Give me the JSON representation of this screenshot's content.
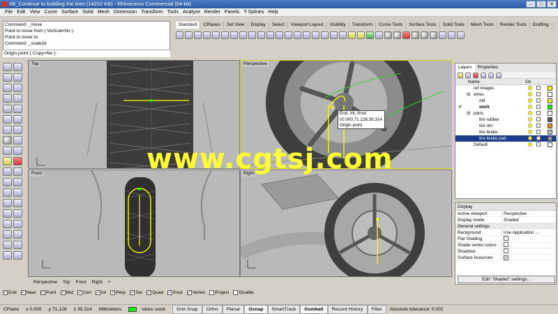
{
  "window": {
    "title": "06_Continue to building the tires (14202 KB) - Rhinoceros Commercial (64-bit)"
  },
  "menu": [
    "File",
    "Edit",
    "View",
    "Curve",
    "Surface",
    "Solid",
    "Mesh",
    "Dimension",
    "Transform",
    "Tools",
    "Analyze",
    "Render",
    "Panels",
    "T-Splines",
    "Help"
  ],
  "command_history": [
    "Command: _move",
    "Point to move from ( Vertical=No ):",
    "Point to move to:",
    "Command: _scale2d"
  ],
  "command_prompt": "Origin point ( Copy=No ):",
  "toolbar_tabs": [
    "Standard",
    "CPlanes",
    "Set View",
    "Display",
    "Select",
    "Viewport Layout",
    "Visibility",
    "Transform",
    "Curve Tools",
    "Surface Tools",
    "Solid Tools",
    "Mesh Tools",
    "Render Tools",
    "Drafting"
  ],
  "viewports": {
    "top": "Top",
    "perspective": "Perspective",
    "front": "Front",
    "right": "Right"
  },
  "snap_tooltip": [
    "End, Int, Knot",
    "c0.000,71.128,35.314",
    "Origin point"
  ],
  "viewport_tabs": [
    "Perspective",
    "Top",
    "Front",
    "Right",
    "+"
  ],
  "osnaps": [
    {
      "label": "End",
      "checked": true
    },
    {
      "label": "Near",
      "checked": true
    },
    {
      "label": "Point",
      "checked": true
    },
    {
      "label": "Mid",
      "checked": true
    },
    {
      "label": "Cen",
      "checked": true
    },
    {
      "label": "Int",
      "checked": true
    },
    {
      "label": "Perp",
      "checked": true
    },
    {
      "label": "Tan",
      "checked": true
    },
    {
      "label": "Quad",
      "checked": true
    },
    {
      "label": "Knot",
      "checked": true
    },
    {
      "label": "Vertex",
      "checked": true
    },
    {
      "label": "Project",
      "checked": false
    },
    {
      "label": "Disable",
      "checked": false
    }
  ],
  "status": {
    "cplane": "CPlane",
    "x": "x 0.000",
    "y": "y 71.128",
    "z": "z 35.314",
    "units": "Millimeters",
    "layer": "wires::work",
    "buttons": [
      {
        "label": "Grid Snap",
        "on": false
      },
      {
        "label": "Ortho",
        "on": false
      },
      {
        "label": "Planar",
        "on": false
      },
      {
        "label": "Osnap",
        "on": true
      },
      {
        "label": "SmartTrack",
        "on": false
      },
      {
        "label": "Gumball",
        "on": true
      },
      {
        "label": "Record History",
        "on": false
      },
      {
        "label": "Filter",
        "on": false
      }
    ],
    "tolerance": "Absolute tolerance: 0.001"
  },
  "layers_panel": {
    "tabs": [
      "Layers",
      "Properties"
    ],
    "header_name": "Name",
    "header_on": "On",
    "rows": [
      {
        "name": "ref images",
        "indent": 1,
        "color": "#ffff00",
        "selected": false,
        "current": false
      },
      {
        "name": "wires",
        "indent": 1,
        "color": "#ffffff",
        "selected": false,
        "current": false,
        "expander": "⊟"
      },
      {
        "name": "old",
        "indent": 2,
        "color": "#ffff00",
        "selected": false,
        "current": false
      },
      {
        "name": "work",
        "indent": 2,
        "color": "#00ff00",
        "selected": false,
        "current": true
      },
      {
        "name": "parts",
        "indent": 1,
        "color": "#ffffff",
        "selected": false,
        "current": false,
        "expander": "⊟"
      },
      {
        "name": "tire rubber",
        "indent": 2,
        "color": "#555555",
        "selected": false,
        "current": false
      },
      {
        "name": "tire rim",
        "indent": 2,
        "color": "#ff8800",
        "selected": false,
        "current": false
      },
      {
        "name": "tire brake",
        "indent": 2,
        "color": "#bbbbbb",
        "selected": false,
        "current": false
      },
      {
        "name": "tire brake pad",
        "indent": 2,
        "color": "#999999",
        "selected": true,
        "current": false
      },
      {
        "name": "Default",
        "indent": 1,
        "color": "#ffffff",
        "selected": false,
        "current": false
      }
    ]
  },
  "display_panel": {
    "title": "Display",
    "rows": [
      {
        "k": "Active viewport",
        "v": "Perspective"
      },
      {
        "k": "Display mode",
        "v": "Shaded"
      }
    ],
    "section": "General settings",
    "settings": [
      {
        "k": "Background",
        "v": "Use Application ..."
      },
      {
        "k": "Flat Shading",
        "check": false
      },
      {
        "k": "Shade vertex colors",
        "check": false
      },
      {
        "k": "Shadows",
        "check": false
      },
      {
        "k": "Surface Isocurves",
        "check": true
      }
    ],
    "edit_button": "Edit \"Shaded\" settings..."
  },
  "watermark": "www.cgtsj.com",
  "colors": {
    "accent": "#ffff00",
    "selection": "#1f3c8a",
    "viewport_bg": "#b9b9b9"
  }
}
